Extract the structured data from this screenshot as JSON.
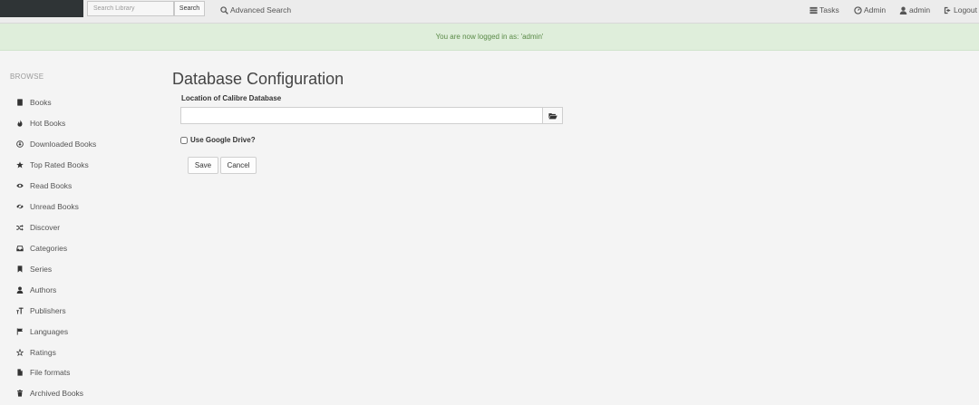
{
  "topbar": {
    "search_placeholder": "Search Library",
    "search_button": "Search",
    "advanced_search": "Advanced Search",
    "tasks": "Tasks",
    "admin": "Admin",
    "user": "admin",
    "logout": "Logout"
  },
  "flash": {
    "message": "You are now logged in as: 'admin'"
  },
  "sidebar": {
    "heading": "BROWSE",
    "items": [
      {
        "label": "Books",
        "icon": "book-icon"
      },
      {
        "label": "Hot Books",
        "icon": "fire-icon"
      },
      {
        "label": "Downloaded Books",
        "icon": "download-icon"
      },
      {
        "label": "Top Rated Books",
        "icon": "star-icon"
      },
      {
        "label": "Read Books",
        "icon": "eye-icon"
      },
      {
        "label": "Unread Books",
        "icon": "eye-slash-icon"
      },
      {
        "label": "Discover",
        "icon": "shuffle-icon"
      },
      {
        "label": "Categories",
        "icon": "inbox-icon"
      },
      {
        "label": "Series",
        "icon": "bookmark-icon"
      },
      {
        "label": "Authors",
        "icon": "user-icon"
      },
      {
        "label": "Publishers",
        "icon": "text-size-icon"
      },
      {
        "label": "Languages",
        "icon": "flag-icon"
      },
      {
        "label": "Ratings",
        "icon": "star-outline-icon"
      },
      {
        "label": "File formats",
        "icon": "file-icon"
      },
      {
        "label": "Archived Books",
        "icon": "trash-icon"
      }
    ]
  },
  "main": {
    "title": "Database Configuration",
    "db_label": "Location of Calibre Database",
    "db_value": "",
    "gdrive_label": "Use Google Drive?",
    "gdrive_checked": false,
    "save_label": "Save",
    "cancel_label": "Cancel"
  }
}
